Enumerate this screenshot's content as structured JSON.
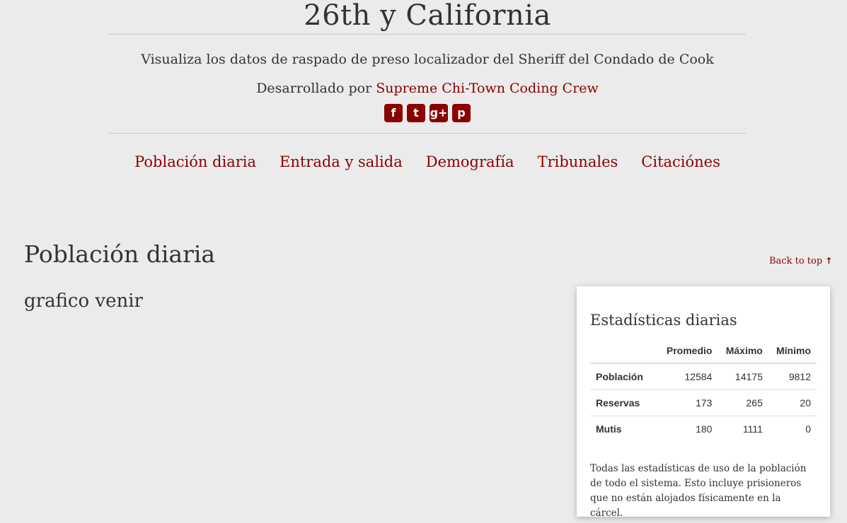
{
  "site": {
    "title": "26th y California",
    "tagline": "Visualiza los datos de raspado de preso localizador del Sheriff del Condado de Cook",
    "byline_prefix": "Desarrollado por ",
    "byline_link": "Supreme Chi-Town Coding Crew"
  },
  "social": [
    {
      "name": "facebook-icon",
      "glyph": "f"
    },
    {
      "name": "twitter-icon",
      "glyph": "t"
    },
    {
      "name": "google-plus-icon",
      "glyph": "g+"
    },
    {
      "name": "pinterest-icon",
      "glyph": "p"
    }
  ],
  "nav": [
    "Población diaria",
    "Entrada y salida",
    "Demografía",
    "Tribunales",
    "Citaciónes"
  ],
  "section": {
    "title": "Población diaria",
    "back_to_top": "Back to top",
    "placeholder": "grafico venir"
  },
  "stats": {
    "title": "Estadísticas diarias",
    "columns": [
      "Promedio",
      "Máximo",
      "Mínimo"
    ],
    "rows": [
      {
        "label": "Población",
        "values": [
          "12584",
          "14175",
          "9812"
        ]
      },
      {
        "label": "Reservas",
        "values": [
          "173",
          "265",
          "20"
        ]
      },
      {
        "label": "Mutis",
        "values": [
          "180",
          "1111",
          "0"
        ]
      }
    ],
    "note": "Todas las estadísticas de uso de la población de todo el sistema. Esto incluye prisioneros que no están alojados físicamente en la cárcel."
  },
  "colors": {
    "accent": "#8b0000",
    "background": "#ebebeb",
    "text": "#333333"
  }
}
